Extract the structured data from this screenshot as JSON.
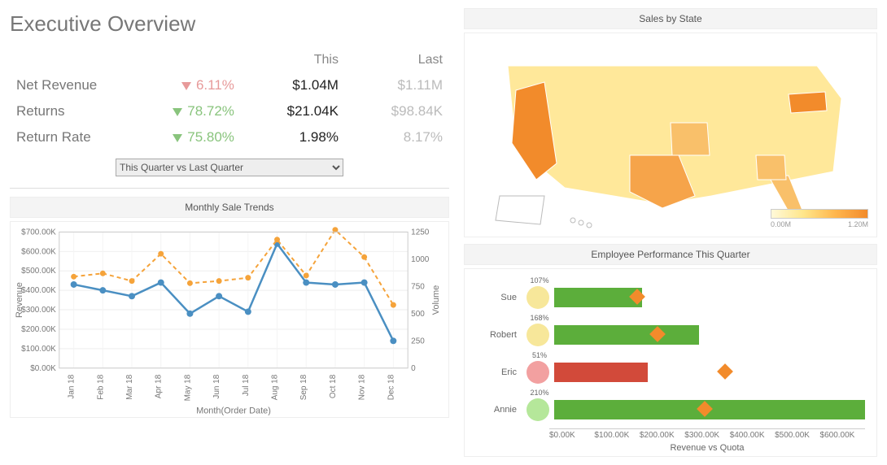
{
  "title": "Executive Overview",
  "kpi": {
    "headers": {
      "this": "This",
      "last": "Last"
    },
    "rows": [
      {
        "label": "Net Revenue",
        "dir": "down",
        "color": "red",
        "pct": "6.11%",
        "this": "$1.04M",
        "last": "$1.11M"
      },
      {
        "label": "Returns",
        "dir": "down",
        "color": "green",
        "pct": "78.72%",
        "this": "$21.04K",
        "last": "$98.84K"
      },
      {
        "label": "Return Rate",
        "dir": "down",
        "color": "green",
        "pct": "75.80%",
        "this": "1.98%",
        "last": "8.17%"
      }
    ],
    "selector": {
      "value": "This Quarter vs Last Quarter"
    }
  },
  "chart_data": [
    {
      "type": "line",
      "title": "Monthly Sale Trends",
      "xlabel": "Month(Order Date)",
      "ylabel": "Revenue",
      "y2label": "Volume",
      "categories": [
        "Jan 18",
        "Feb 18",
        "Mar 18",
        "Apr 18",
        "May 18",
        "Jun 18",
        "Jul 18",
        "Aug 18",
        "Sep 18",
        "Oct 18",
        "Nov 18",
        "Dec 18"
      ],
      "y_ticks": [
        "$0.00K",
        "$100.00K",
        "$200.00K",
        "$300.00K",
        "$400.00K",
        "$500.00K",
        "$600.00K",
        "$700.00K"
      ],
      "y2_ticks": [
        0,
        250,
        500,
        750,
        1000,
        1250
      ],
      "series": [
        {
          "name": "Revenue ($K)",
          "axis": "left",
          "values": [
            430,
            400,
            370,
            440,
            280,
            370,
            290,
            640,
            440,
            430,
            440,
            140
          ]
        },
        {
          "name": "Volume",
          "axis": "right",
          "values": [
            840,
            870,
            800,
            1050,
            780,
            800,
            830,
            1180,
            850,
            1270,
            1020,
            580
          ]
        }
      ]
    },
    {
      "type": "map",
      "title": "Sales by State",
      "legend": {
        "min": "0.00M",
        "max": "1.20M"
      },
      "top_states": [
        {
          "state": "CA",
          "value": 1.1
        },
        {
          "state": "TX",
          "value": 0.95
        },
        {
          "state": "PA",
          "value": 0.9
        },
        {
          "state": "MO",
          "value": 0.7
        },
        {
          "state": "GA",
          "value": 0.6
        },
        {
          "state": "FL",
          "value": 0.55
        }
      ]
    },
    {
      "type": "bar",
      "title": "Employee Performance This Quarter",
      "xlabel": "Revenue vs Quota",
      "x_ticks": [
        "$0.00K",
        "$100.00K",
        "$200.00K",
        "$300.00K",
        "$400.00K",
        "$500.00K",
        "$600.00K"
      ],
      "x_max": 600,
      "rows": [
        {
          "name": "Sue",
          "pct": "107%",
          "bubble": "#f7e79a",
          "revenue": 170,
          "quota": 160,
          "bar_color": "#5cae3b"
        },
        {
          "name": "Robert",
          "pct": "168%",
          "bubble": "#f7e79a",
          "revenue": 280,
          "quota": 200,
          "bar_color": "#5cae3b"
        },
        {
          "name": "Eric",
          "pct": "51%",
          "bubble": "#f2a0a0",
          "revenue": 180,
          "quota": 330,
          "bar_color": "#d24a3a"
        },
        {
          "name": "Annie",
          "pct": "210%",
          "bubble": "#b5e79a",
          "revenue": 600,
          "quota": 290,
          "bar_color": "#5cae3b"
        }
      ]
    }
  ]
}
